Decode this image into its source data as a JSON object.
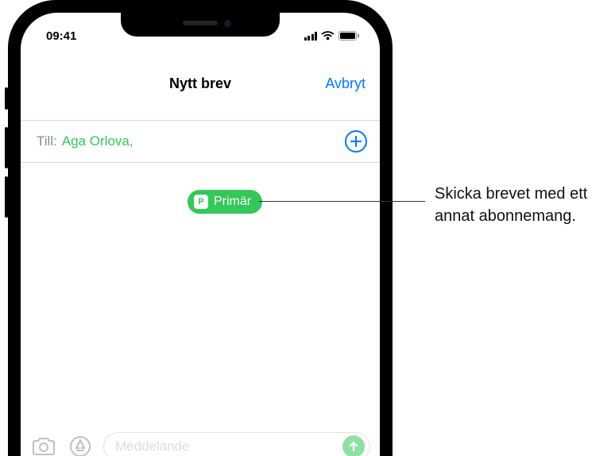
{
  "status": {
    "time": "09:41"
  },
  "navbar": {
    "title": "Nytt brev",
    "cancel": "Avbryt"
  },
  "compose": {
    "to_label": "Till:",
    "recipient": "Aga Orlova",
    "comma": ","
  },
  "sim": {
    "badge": "P",
    "label": "Primär"
  },
  "input": {
    "placeholder": "Meddelande"
  },
  "callout": {
    "text": "Skicka brevet med ett annat abonnemang."
  }
}
